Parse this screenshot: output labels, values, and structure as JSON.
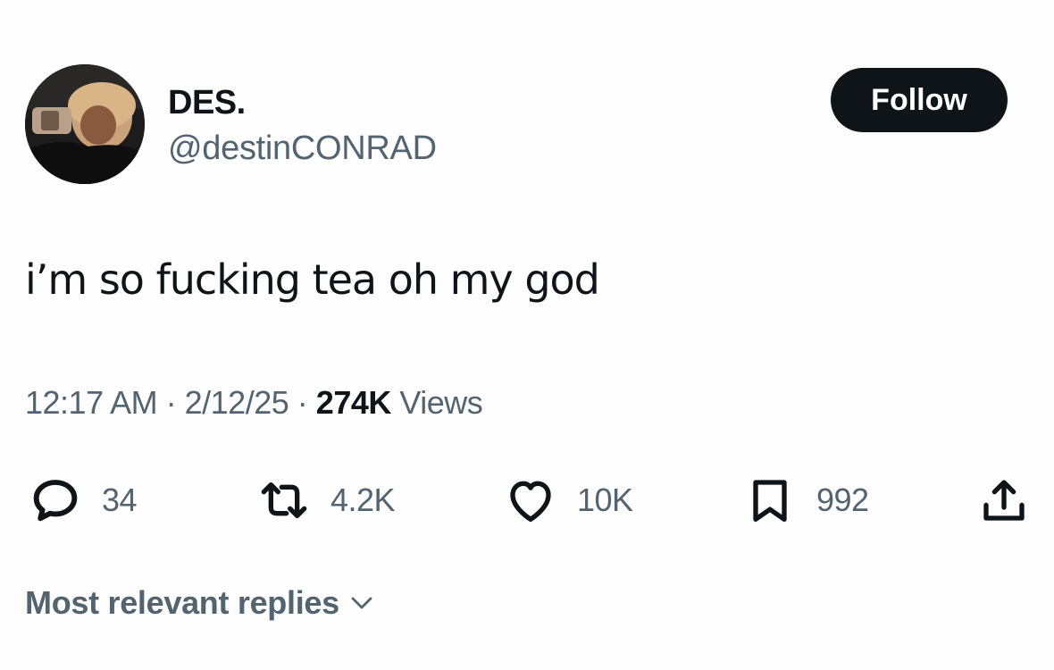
{
  "author": {
    "display_name": "DES.",
    "handle": "@destinCONRAD",
    "avatar": "profile-photo"
  },
  "follow_button": {
    "label": "Follow"
  },
  "tweet": {
    "text": "i’m so fucking tea oh my god",
    "time": "12:17 AM",
    "separator": "·",
    "date": "2/12/25",
    "views_count": "274K",
    "views_label": "Views"
  },
  "actions": {
    "replies": {
      "icon": "reply-icon",
      "count": "34"
    },
    "reposts": {
      "icon": "repost-icon",
      "count": "4.2K"
    },
    "likes": {
      "icon": "heart-icon",
      "count": "10K"
    },
    "bookmarks": {
      "icon": "bookmark-icon",
      "count": "992"
    },
    "share": {
      "icon": "share-icon"
    }
  },
  "replies_sort": {
    "label": "Most relevant replies",
    "icon": "chevron-down-icon"
  },
  "colors": {
    "text_primary": "#0f1419",
    "text_secondary": "#536471",
    "button_bg": "#0f1419",
    "background": "#fdfdfd"
  }
}
